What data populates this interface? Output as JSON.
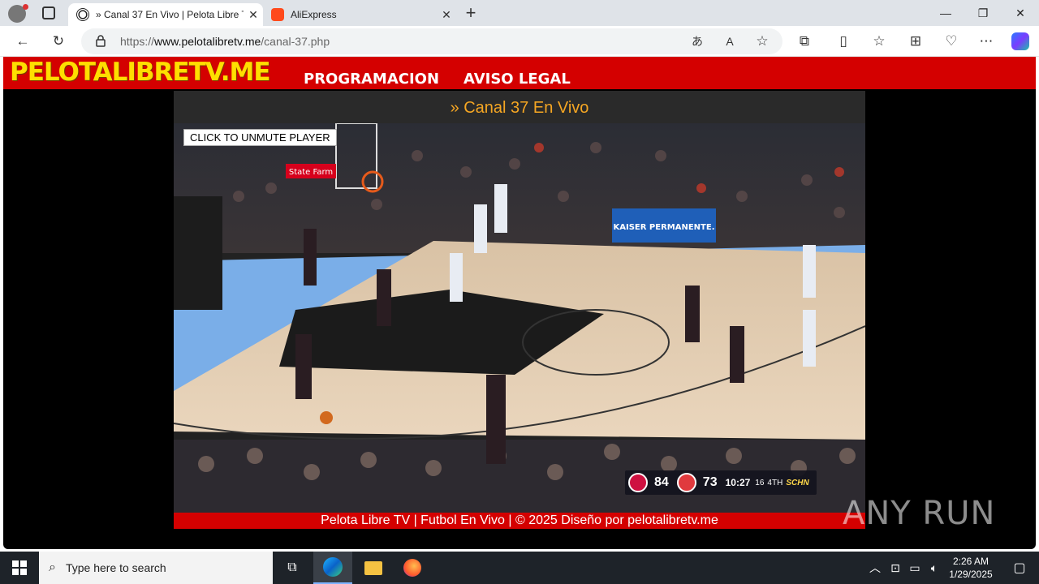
{
  "browser": {
    "tabs": [
      {
        "label": "» Canal 37 En Vivo | Pelota Libre T"
      },
      {
        "label": "AliExpress"
      }
    ],
    "url_prefix": "https://",
    "url_host": "www.pelotalibretv.me",
    "url_path": "/canal-37.php"
  },
  "site": {
    "logo": "PELOTALIBRETV.ME",
    "nav": [
      "PROGRAMACION",
      "AVISO LEGAL"
    ],
    "channel_title": "» Canal 37 En Vivo",
    "unmute_label": "CLICK TO UNMUTE PLAYER",
    "footer": "Pelota Libre TV | Futbol En Vivo | © 2025 Diseño por pelotalibretv.me"
  },
  "video": {
    "home_score": "84",
    "away_score": "73",
    "clock": "10:27",
    "shot_clock": "16",
    "period": "4TH",
    "network": "SCHN",
    "court_sign": "KAISER PERMANENTE.",
    "sponsor": "State Farm"
  },
  "watermark": "ANY RUN",
  "taskbar": {
    "search_placeholder": "Type here to search",
    "time": "2:26 AM",
    "date": "1/29/2025"
  },
  "colors": {
    "site_red": "#d40000",
    "logo_yellow": "#ffde00",
    "title_orange": "#f5a623"
  }
}
